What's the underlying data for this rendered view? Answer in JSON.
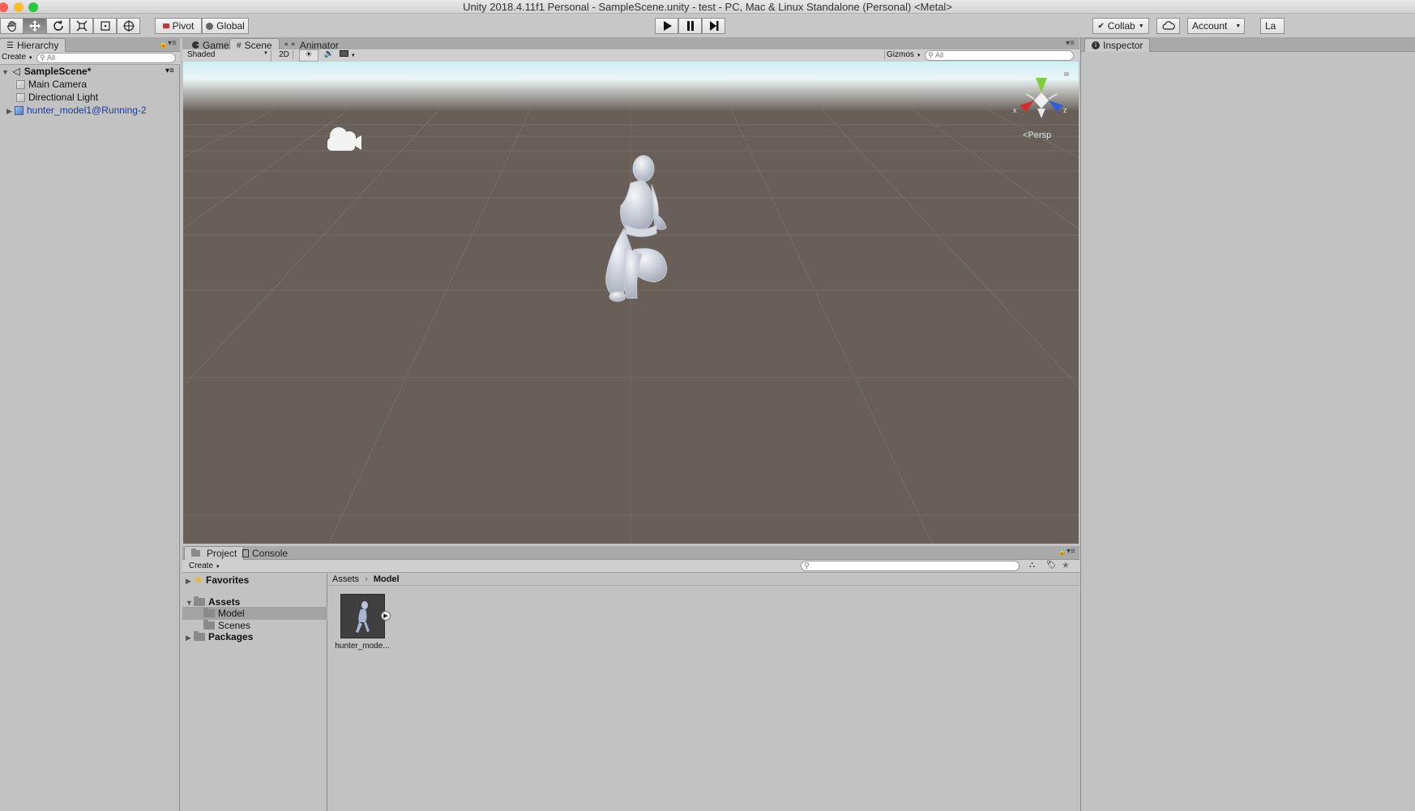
{
  "window": {
    "title": "Unity 2018.4.11f1 Personal - SampleScene.unity - test - PC, Mac & Linux Standalone (Personal) <Metal>"
  },
  "toolbar": {
    "pivot_label": "Pivot",
    "global_label": "Global",
    "collab_label": "Collab",
    "account_label": "Account",
    "layers_label": "La"
  },
  "hierarchy": {
    "tab_label": "Hierarchy",
    "create_label": "Create",
    "search_placeholder": "All",
    "scene_name": "SampleScene*",
    "items": [
      {
        "label": "Main Camera"
      },
      {
        "label": "Directional Light"
      },
      {
        "label": "hunter_model1@Running-2"
      }
    ]
  },
  "scene_view": {
    "tabs": [
      {
        "label": "Game"
      },
      {
        "label": "Scene"
      },
      {
        "label": "Animator"
      }
    ],
    "shading_mode": "Shaded",
    "mode_2d_label": "2D",
    "gizmos_label": "Gizmos",
    "search_placeholder": "All",
    "persp_label": "Persp",
    "axis_x_label": "x",
    "axis_z_label": "z",
    "colors": {
      "axis_x": "#d62b2b",
      "axis_y": "#7fcf3a",
      "axis_z": "#2f5fd6"
    }
  },
  "inspector": {
    "tab_label": "Inspector"
  },
  "project": {
    "tabs": [
      {
        "label": "Project"
      },
      {
        "label": "Console"
      }
    ],
    "create_label": "Create",
    "tree": {
      "favorites": "Favorites",
      "assets": "Assets",
      "model": "Model",
      "scenes": "Scenes",
      "packages": "Packages"
    },
    "breadcrumb": {
      "root": "Assets",
      "current": "Model"
    },
    "asset_name": "hunter_mode..."
  }
}
